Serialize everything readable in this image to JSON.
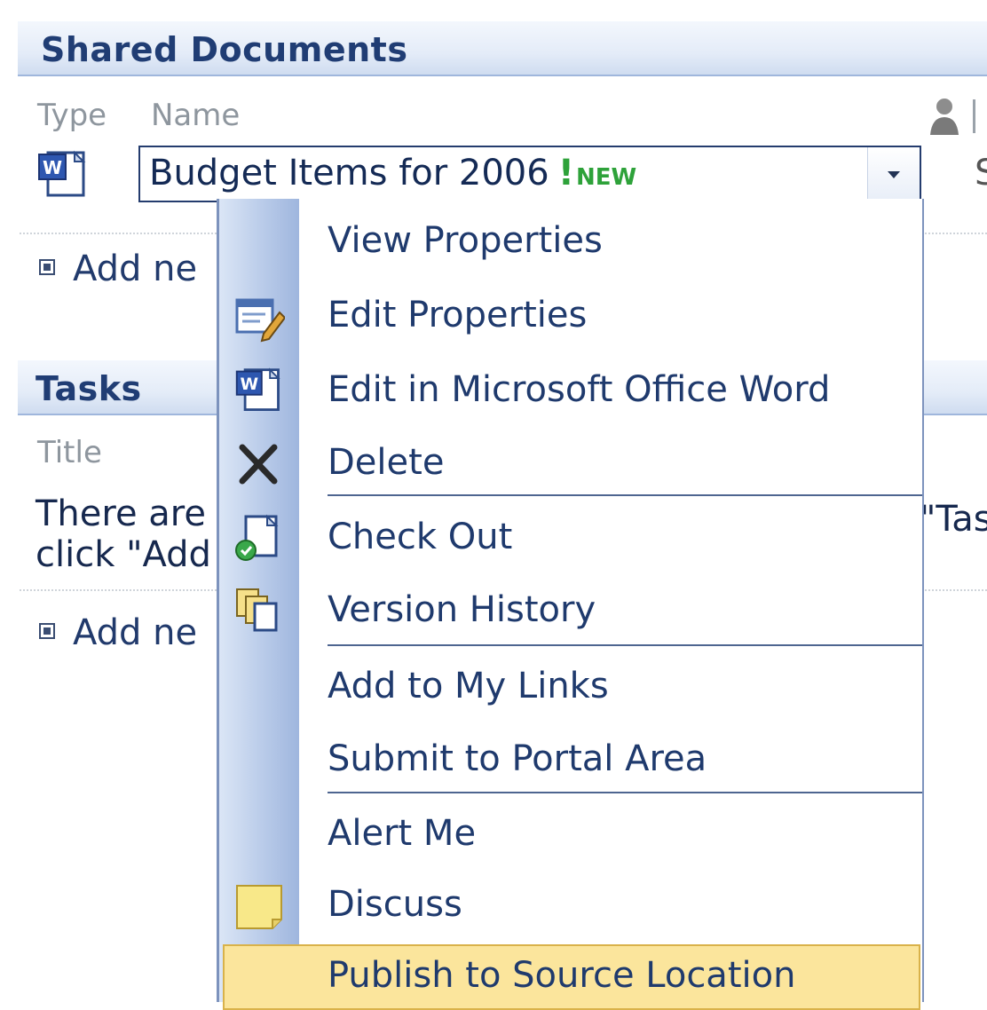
{
  "shared_documents": {
    "title": "Shared Documents",
    "col_type": "Type",
    "col_name": "Name",
    "document": {
      "name": "Budget Items for 2006",
      "exclaim": "!",
      "new_tag": "NEW",
      "right_edge_partial": "S"
    },
    "add_new_partial": "Add ne",
    "icon": "word-document-icon"
  },
  "tasks": {
    "title": "Tasks",
    "col_title": "Title",
    "empty_line1_partial": "There are",
    "empty_line2_partial": "click \"Add",
    "right_partial": "\"Tas",
    "add_new_partial": "Add ne"
  },
  "context_menu": {
    "items": [
      {
        "label": "View Properties",
        "icon": ""
      },
      {
        "label": "Edit Properties",
        "icon": "edit-properties-icon"
      },
      {
        "label": "Edit in Microsoft Office Word",
        "icon": "word-document-icon"
      },
      {
        "label": "Delete",
        "icon": "delete-x-icon"
      },
      {
        "label": "Check Out",
        "icon": "check-out-icon"
      },
      {
        "label": "Version History",
        "icon": "version-history-icon"
      },
      {
        "label": "Add to My Links",
        "icon": ""
      },
      {
        "label": "Submit to Portal Area",
        "icon": ""
      },
      {
        "label": "Alert Me",
        "icon": ""
      },
      {
        "label": "Discuss",
        "icon": "discuss-note-icon"
      },
      {
        "label": "Publish to Source Location",
        "icon": "",
        "highlighted": true
      }
    ]
  },
  "colors": {
    "header_text": "#203d74",
    "new_green": "#2ea23a",
    "menu_highlight": "#fbe59c",
    "menu_strip": "#b9cbe9"
  }
}
